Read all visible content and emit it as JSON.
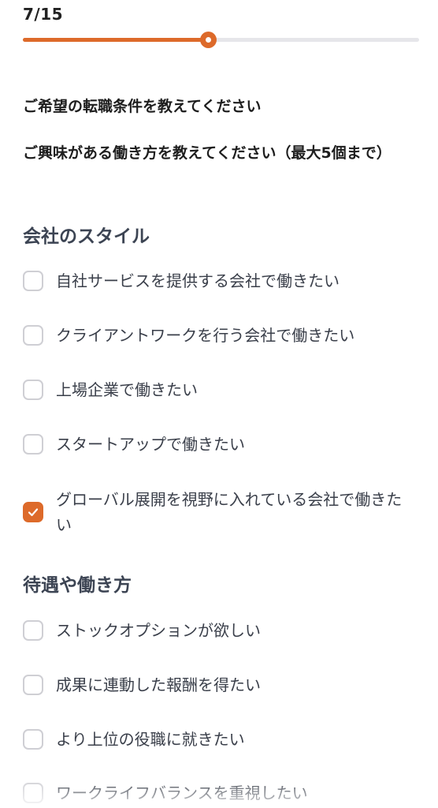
{
  "progress": {
    "count": "7/15",
    "current": 7,
    "total": 15,
    "color": "#dd6a2a"
  },
  "heading1": "ご希望の転職条件を教えてください",
  "heading2": "ご興味がある働き方を教えてください（最大5個まで）",
  "sections": [
    {
      "title": "会社のスタイル",
      "options": [
        {
          "label": "自社サービスを提供する会社で働きたい",
          "checked": false
        },
        {
          "label": "クライアントワークを行う会社で働きたい",
          "checked": false
        },
        {
          "label": "上場企業で働きたい",
          "checked": false
        },
        {
          "label": "スタートアップで働きたい",
          "checked": false
        },
        {
          "label": "グローバル展開を視野に入れている会社で働きたい",
          "checked": true
        }
      ]
    },
    {
      "title": "待遇や働き方",
      "options": [
        {
          "label": "ストックオプションが欲しい",
          "checked": false
        },
        {
          "label": "成果に連動した報酬を得たい",
          "checked": false
        },
        {
          "label": "より上位の役職に就きたい",
          "checked": false
        },
        {
          "label": "ワークライフバランスを重視したい",
          "checked": false
        }
      ]
    }
  ],
  "icons": {
    "check": "check-icon"
  }
}
